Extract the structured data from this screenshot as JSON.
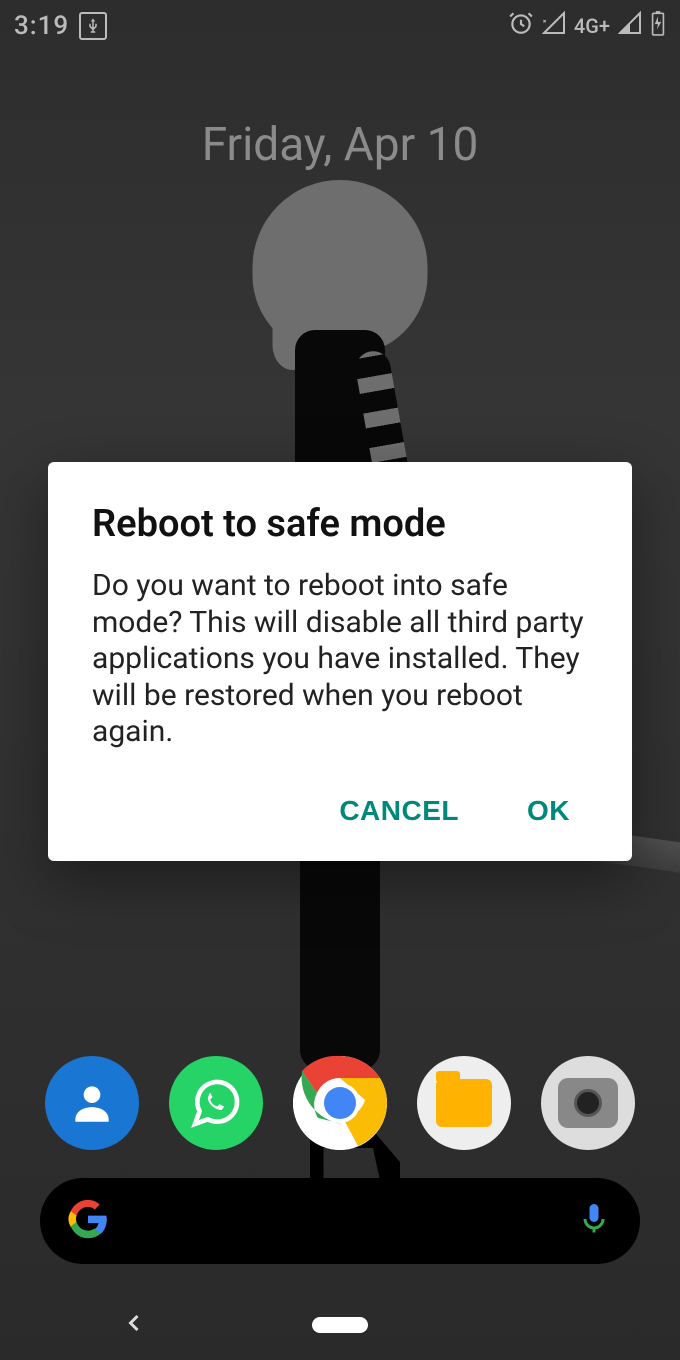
{
  "status_bar": {
    "time": "3:19",
    "network_label": "4G+",
    "icons": [
      "usb",
      "alarm",
      "signal-no-data",
      "signal",
      "battery-charging"
    ]
  },
  "home": {
    "date": "Friday, Apr 10"
  },
  "dock": {
    "apps": [
      "contacts",
      "whatsapp",
      "chrome",
      "files",
      "camera"
    ]
  },
  "dialog": {
    "title": "Reboot to safe mode",
    "message": "Do you want to reboot into safe mode? This will disable all third party applications you have installed. They will be restored when you reboot again.",
    "cancel_label": "CANCEL",
    "ok_label": "OK"
  }
}
